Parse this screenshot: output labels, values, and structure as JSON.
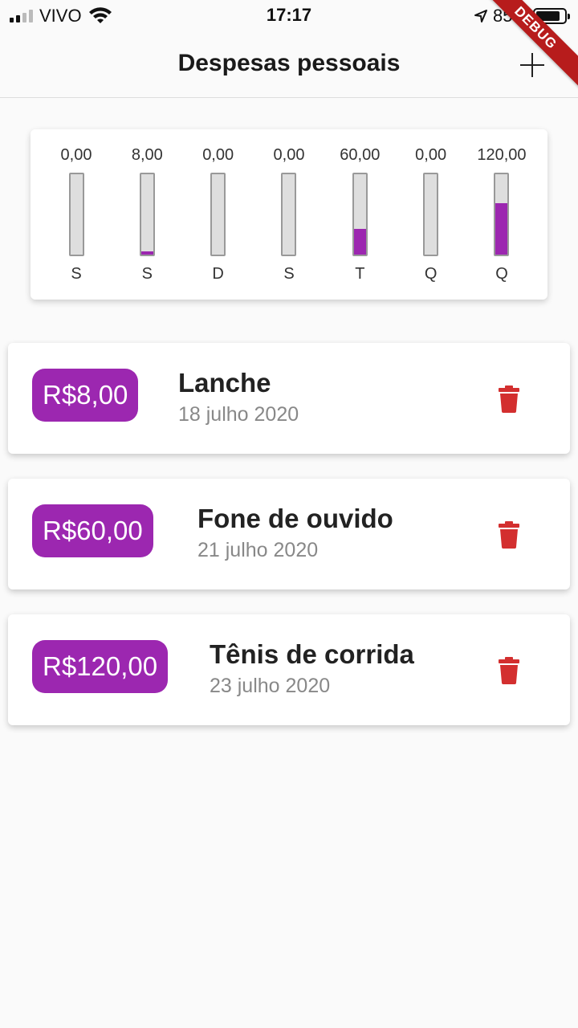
{
  "status_bar": {
    "carrier": "VIVO",
    "time": "17:17",
    "battery": "85%",
    "battery_level": 0.85,
    "signal_bars": 4,
    "signal_active": 2
  },
  "app_bar": {
    "title": "Despesas pessoais",
    "add_icon": "plus-icon",
    "debug_label": "DEBUG"
  },
  "chart": {
    "bars": [
      {
        "day": "S",
        "value_label": "0,00",
        "fraction": 0.0
      },
      {
        "day": "S",
        "value_label": "8,00",
        "fraction": 0.0425
      },
      {
        "day": "D",
        "value_label": "0,00",
        "fraction": 0.0
      },
      {
        "day": "S",
        "value_label": "0,00",
        "fraction": 0.0
      },
      {
        "day": "T",
        "value_label": "60,00",
        "fraction": 0.319
      },
      {
        "day": "Q",
        "value_label": "0,00",
        "fraction": 0.0
      },
      {
        "day": "Q",
        "value_label": "120,00",
        "fraction": 0.638
      }
    ],
    "fill_color": "#9c27b0",
    "track_color": "#dedede"
  },
  "transactions": [
    {
      "price": "R$8,00",
      "title": "Lanche",
      "date": "18 julho 2020",
      "delete_icon": "trash-icon"
    },
    {
      "price": "R$60,00",
      "title": "Fone de ouvido",
      "date": "21 julho 2020",
      "delete_icon": "trash-icon"
    },
    {
      "price": "R$120,00",
      "title": "Tênis de corrida",
      "date": "23 julho 2020",
      "delete_icon": "trash-icon"
    }
  ],
  "colors": {
    "primary": "#9c27b0",
    "delete": "#d32f2f",
    "debug_banner": "#b71c1c"
  }
}
